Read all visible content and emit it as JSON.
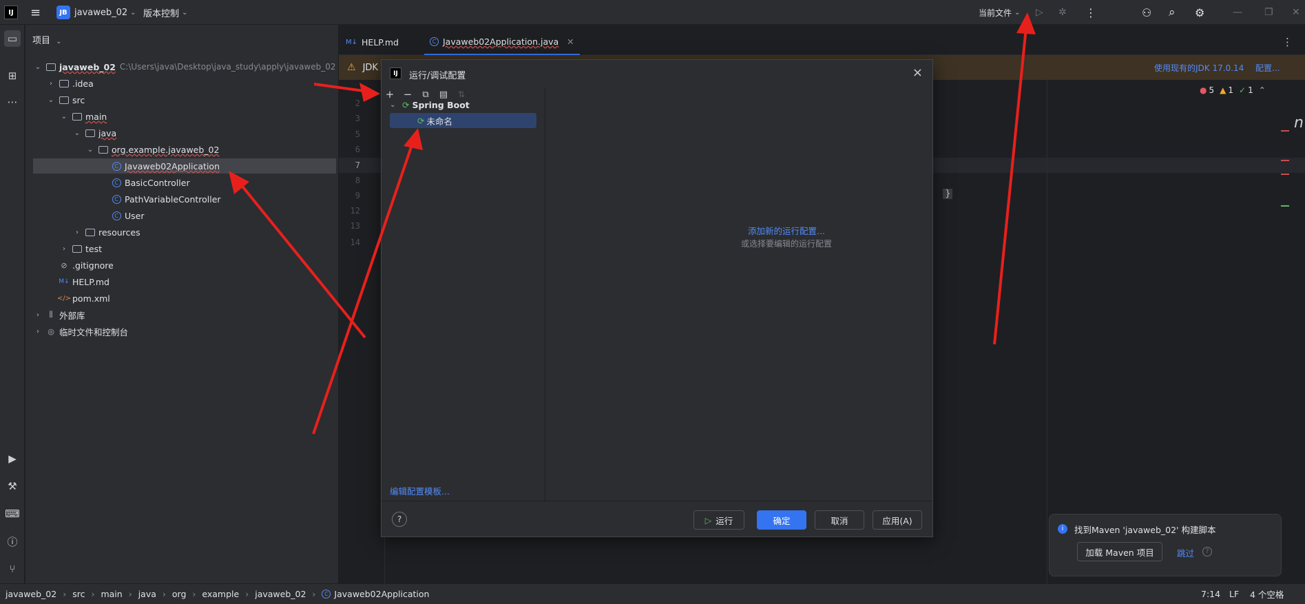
{
  "titlebar": {
    "logo": "IJ",
    "project_badge": "JB",
    "project_name": "javaweb_02",
    "vcs_label": "版本控制",
    "run_target": "当前文件"
  },
  "panel": {
    "title": "项目"
  },
  "tree": [
    {
      "label": "javaweb_02",
      "hint": "C:\\Users\\java\\Desktop\\java_study\\apply\\javaweb_02",
      "type": "module"
    },
    {
      "label": ".idea",
      "type": "folder"
    },
    {
      "label": "src",
      "type": "folder"
    },
    {
      "label": "main",
      "type": "folder"
    },
    {
      "label": "java",
      "type": "folder"
    },
    {
      "label": "org.example.javaweb_02",
      "type": "package"
    },
    {
      "label": "Javaweb02Application",
      "type": "class"
    },
    {
      "label": "BasicController",
      "type": "class"
    },
    {
      "label": "PathVariableController",
      "type": "class"
    },
    {
      "label": "User",
      "type": "class"
    },
    {
      "label": "resources",
      "type": "folder"
    },
    {
      "label": "test",
      "type": "folder"
    },
    {
      "label": ".gitignore",
      "type": "ignore"
    },
    {
      "label": "HELP.md",
      "type": "md"
    },
    {
      "label": "pom.xml",
      "type": "xml"
    },
    {
      "label": "外部库",
      "type": "lib"
    },
    {
      "label": "临时文件和控制台",
      "type": "scratch"
    }
  ],
  "tabs": [
    {
      "label": "HELP.md",
      "prefix": "M↓"
    },
    {
      "label": "Javaweb02Application.java"
    }
  ],
  "banner": {
    "text": "JDK",
    "action1": "使用现有的JDK 17.0.14",
    "action2": "配置..."
  },
  "inspections": {
    "errors": "5",
    "warnings": "1",
    "ok": "1"
  },
  "gutter_lines": [
    "2",
    "3",
    "5",
    "6",
    "7",
    "8",
    "9",
    "12",
    "13",
    "14"
  ],
  "code_fragment": ");",
  "code_brace": "}",
  "dialog": {
    "title": "运行/调试配置",
    "group": "Spring Boot",
    "item": "未命名",
    "add_link": "添加新的运行配置...",
    "hint": "或选择要编辑的运行配置",
    "edit_templates": "编辑配置模板...",
    "help": "?",
    "run_btn": "运行",
    "ok_btn": "确定",
    "cancel_btn": "取消",
    "apply_btn": "应用(A)"
  },
  "notification": {
    "text": "找到Maven 'javaweb_02' 构建脚本",
    "load_btn": "加载 Maven 项目",
    "skip": "跳过"
  },
  "breadcrumb": [
    "javaweb_02",
    "src",
    "main",
    "java",
    "org",
    "example",
    "javaweb_02",
    "Javaweb02Application"
  ],
  "status": {
    "position": "7:14",
    "line_sep": "LF",
    "indent": "4 个空格"
  },
  "right_edge_letter": "n",
  "colors": {
    "accent": "#3574f0",
    "link": "#548af7",
    "annotation_arrow": "#e8201c",
    "warning_bg": "#3d3223"
  }
}
